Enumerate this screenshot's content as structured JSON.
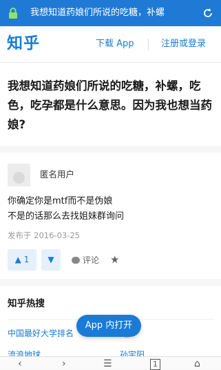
{
  "browser": {
    "url_text": "我想知道药娘们所说的吃糖，补螺"
  },
  "header": {
    "logo": "知乎",
    "download_app": "下载 App",
    "login": "注册或登录"
  },
  "question": {
    "title": "我想知道药娘们所说的吃糖，补螺，吃色，吃孕都是什么意思。因为我也想当药娘?"
  },
  "answer": {
    "author": "匿名用户",
    "lines": [
      "你确定你是mtf而不是伪娘",
      "不是的话那么去找姐妹群询问"
    ],
    "date": "发布于 2016-03-25",
    "vote_up_label": "▲ 1",
    "vote_down_label": "▼",
    "comment_label": "评论",
    "star_label": "★"
  },
  "hot": {
    "title": "知乎热搜",
    "items": [
      "中国最好大学排名",
      "",
      "",
      "孙宇阳"
    ],
    "item_partial_1": "流浪地球",
    "fire_label": "🔥"
  },
  "open_app": "App 内打开",
  "navbar": {
    "back": "‹",
    "forward": "›",
    "menu": "☰",
    "tabs": "1",
    "home": "⌂"
  },
  "colors": {
    "url_bar": "#1f7ad6",
    "brand": "#1a7bd7",
    "fire": "#f1403c"
  }
}
